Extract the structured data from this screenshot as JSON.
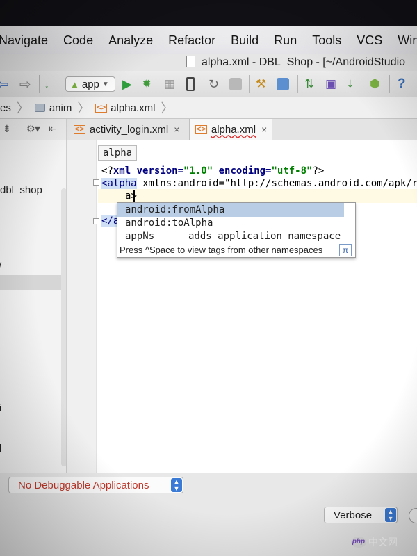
{
  "menu": {
    "items": [
      "Navigate",
      "Code",
      "Analyze",
      "Refactor",
      "Build",
      "Run",
      "Tools",
      "VCS",
      "Win"
    ]
  },
  "window": {
    "title": "alpha.xml - DBL_Shop - [~/AndroidStudio"
  },
  "toolbar": {
    "run_config": "app",
    "icons": [
      "back-icon",
      "forward-icon",
      "make-project-icon",
      "run-icon",
      "debug-icon",
      "coverage-icon",
      "apply-changes-icon",
      "attach-debugger-icon",
      "stop-icon",
      "project-structure-icon",
      "sdk-manager-icon",
      "sync-gradle-icon",
      "avd-manager-icon",
      "device-monitor-icon",
      "android-icon",
      "help-icon"
    ]
  },
  "breadcrumbs": [
    "es",
    "anim",
    "alpha.xml"
  ],
  "project": {
    "tree_label": "dbl_shop",
    "truncated_marks": [
      "/",
      "i",
      "l"
    ]
  },
  "tabs": [
    {
      "label": "activity_login.xml",
      "close": "×"
    },
    {
      "label": "alpha.xml",
      "close": "×"
    }
  ],
  "editor": {
    "tag_breadcrumb": "alpha",
    "lines": {
      "prolog_start": "<?",
      "prolog_kw": "xml",
      "prolog_attr1": " version=",
      "prolog_val1": "\"1.0\"",
      "prolog_attr2": " encoding=",
      "prolog_val2": "\"utf-8\"",
      "prolog_end": "?>",
      "root_tag": "<alpha",
      "root_rest": " xmlns:android=\"http://schemas.android.com/apk/r",
      "typed": "a",
      "typed_close": ">",
      "close_tag": "</a"
    }
  },
  "completion": {
    "items": [
      {
        "name": "android:fromAlpha",
        "desc": ""
      },
      {
        "name": "android:toAlpha",
        "desc": ""
      },
      {
        "name": "appNs",
        "desc": "adds application namespace"
      }
    ],
    "hint": "Press ^Space to view tags from other namespaces",
    "pi_label": "π"
  },
  "logcat": {
    "device": "No Debuggable Applications",
    "level": "Verbose"
  },
  "watermark": {
    "badge": "php",
    "text": "中文网"
  },
  "colors": {
    "selection": "#b9cde4",
    "error_text": "#c0392b",
    "keyword": "#000080",
    "string": "#008000"
  }
}
